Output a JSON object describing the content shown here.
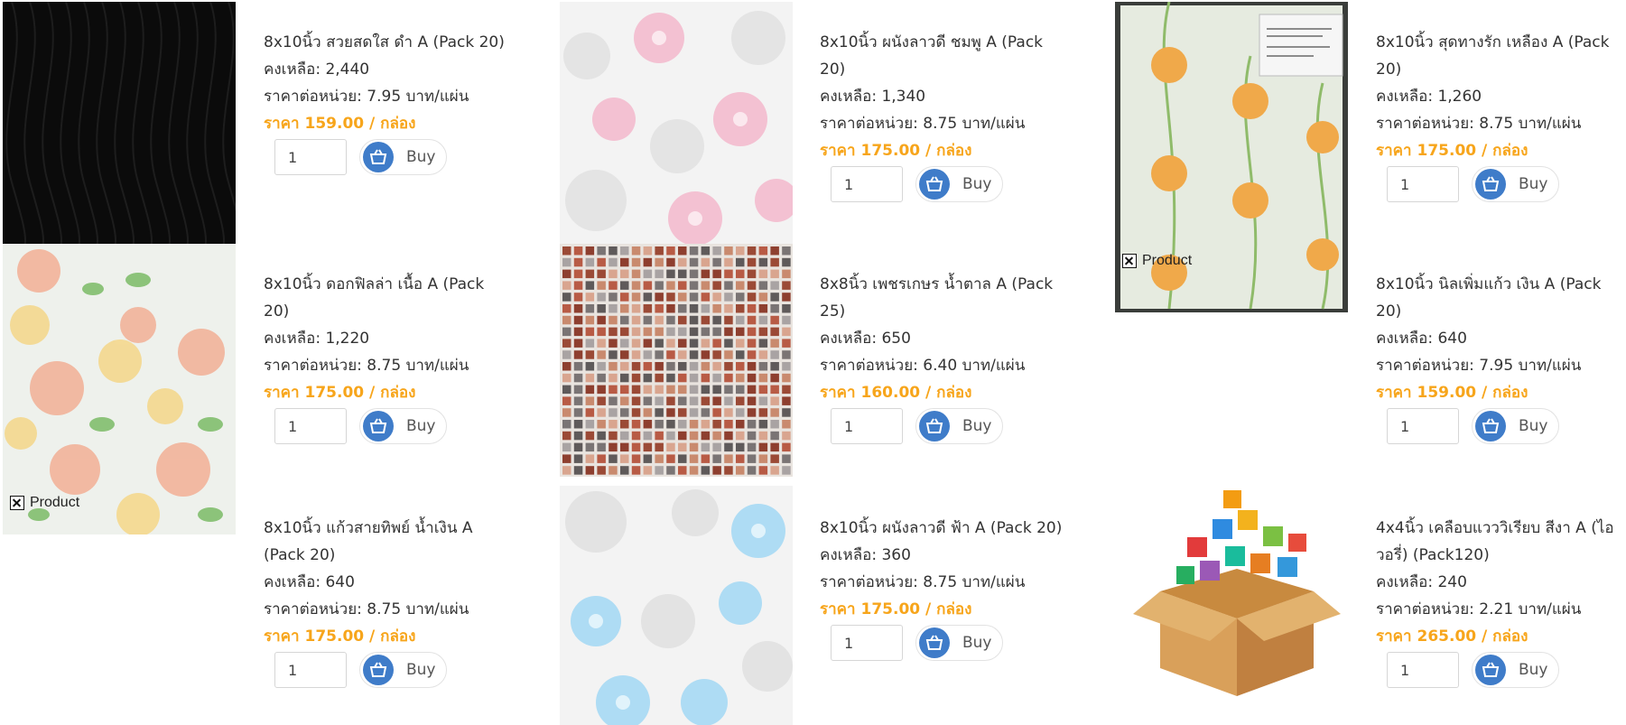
{
  "broken_alt": "Product",
  "products": [
    {
      "name": "8x10นิ้ว สวยสดใส ดำ A (Pack 20)",
      "stock": "คงเหลือ: 2,440",
      "unit": "ราคาต่อหน่วย: 7.95 บาท/แผ่น",
      "price": "ราคา 159.00 / กล่อง",
      "qty": "1",
      "buy": "Buy"
    },
    {
      "name": "8x10นิ้ว ผนังลาวดี ชมพู A (Pack 20)",
      "stock": "คงเหลือ: 1,340",
      "unit": "ราคาต่อหน่วย: 8.75 บาท/แผ่น",
      "price": "ราคา 175.00 / กล่อง",
      "qty": "1",
      "buy": "Buy"
    },
    {
      "name": "8x10นิ้ว สุดทางรัก เหลือง A (Pack 20)",
      "stock": "คงเหลือ: 1,260",
      "unit": "ราคาต่อหน่วย: 8.75 บาท/แผ่น",
      "price": "ราคา 175.00 / กล่อง",
      "qty": "1",
      "buy": "Buy"
    },
    {
      "name": "8x10นิ้ว ดอกฟิลล่า เนื้อ A (Pack 20)",
      "stock": "คงเหลือ: 1,220",
      "unit": "ราคาต่อหน่วย: 8.75 บาท/แผ่น",
      "price": "ราคา 175.00 / กล่อง",
      "qty": "1",
      "buy": "Buy"
    },
    {
      "name": "8x8นิ้ว เพชรเกษร น้ำตาล A (Pack 25)",
      "stock": "คงเหลือ: 650",
      "unit": "ราคาต่อหน่วย: 6.40 บาท/แผ่น",
      "price": "ราคา 160.00 / กล่อง",
      "qty": "1",
      "buy": "Buy"
    },
    {
      "name": "8x10นิ้ว นิลเพิ่มแก้ว เงิน A (Pack 20)",
      "stock": "คงเหลือ: 640",
      "unit": "ราคาต่อหน่วย: 7.95 บาท/แผ่น",
      "price": "ราคา 159.00 / กล่อง",
      "qty": "1",
      "buy": "Buy"
    },
    {
      "name": "8x10นิ้ว แก้วสายทิพย์ น้ำเงิน A (Pack 20)",
      "stock": "คงเหลือ: 640",
      "unit": "ราคาต่อหน่วย: 8.75 บาท/แผ่น",
      "price": "ราคา 175.00 / กล่อง",
      "qty": "1",
      "buy": "Buy"
    },
    {
      "name": "8x10นิ้ว ผนังลาวดี ฟ้า A (Pack 20)",
      "stock": "คงเหลือ: 360",
      "unit": "ราคาต่อหน่วย: 8.75 บาท/แผ่น",
      "price": "ราคา 175.00 / กล่อง",
      "qty": "1",
      "buy": "Buy"
    },
    {
      "name": "4x4นิ้ว เคลือบแวววิเรียบ สีงา A (ไอวอรี่) (Pack120)",
      "stock": "คงเหลือ: 240",
      "unit": "ราคาต่อหน่วย: 2.21 บาท/แผ่น",
      "price": "ราคา 265.00 / กล่อง",
      "qty": "1",
      "buy": "Buy"
    }
  ],
  "colors": {
    "price": "#f7a51b",
    "buy_circle": "#3f7cc9"
  },
  "icons": {
    "buy": "basket-icon",
    "broken_image": "broken-image-icon"
  }
}
